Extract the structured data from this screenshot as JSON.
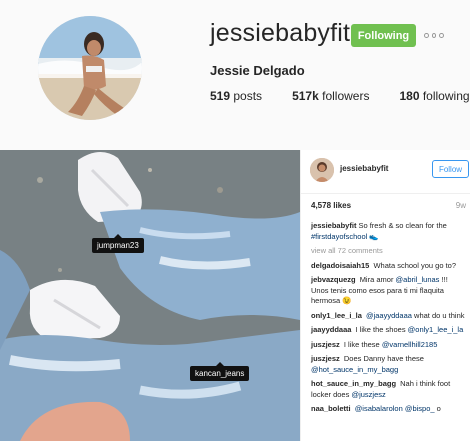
{
  "profile": {
    "username": "jessiebabyfit",
    "full_name": "Jessie Delgado",
    "follow_button": "Following",
    "more_icon": "more-options-icon",
    "stats": {
      "posts_num": "519",
      "posts_label": "posts",
      "followers_num": "517k",
      "followers_label": "followers",
      "following_num": "180",
      "following_label": "following"
    }
  },
  "post": {
    "tags": [
      "jumpman23",
      "kancan_jeans"
    ],
    "side": {
      "username": "jessiebabyfit",
      "follow_button": "Follow",
      "likes": "4,578 likes",
      "time": "9w"
    },
    "caption": {
      "user": "jessiebabyfit",
      "text": "So fresh & so clean for the",
      "hashtag": "#firstdayofschool",
      "emoji": "👟"
    },
    "view_all": "view all 72 comments",
    "comments": [
      {
        "user": "delgadoisaiah15",
        "text": "Whata school you go to?"
      },
      {
        "user": "jebvazquezg",
        "text": "Mira amor",
        "mention": "@abril_lunas",
        "after": "!!! Unos tenis como esos para ti mi flaquita hermosa 😉"
      },
      {
        "user": "only1_lee_i_la",
        "mention": "@jaayyddaaa",
        "text": "what do u think"
      },
      {
        "user": "jaayyddaaa",
        "text": "I like the shoes",
        "mention": "@only1_lee_i_la"
      },
      {
        "user": "juszjesz",
        "text": "I like these",
        "mention": "@varnellhill2185"
      },
      {
        "user": "juszjesz",
        "text": "Does Danny have these",
        "mention": "@hot_sauce_in_my_bagg"
      },
      {
        "user": "hot_sauce_in_my_bagg",
        "text": "Nah i think foot locker does",
        "mention": "@juszjesz"
      },
      {
        "user": "naa_boletti",
        "mention": "@isabalarolon @bispo_",
        "text": "o"
      }
    ]
  },
  "colors": {
    "following_green": "#70c050",
    "follow_blue": "#3897f0",
    "link_blue": "#003569"
  }
}
